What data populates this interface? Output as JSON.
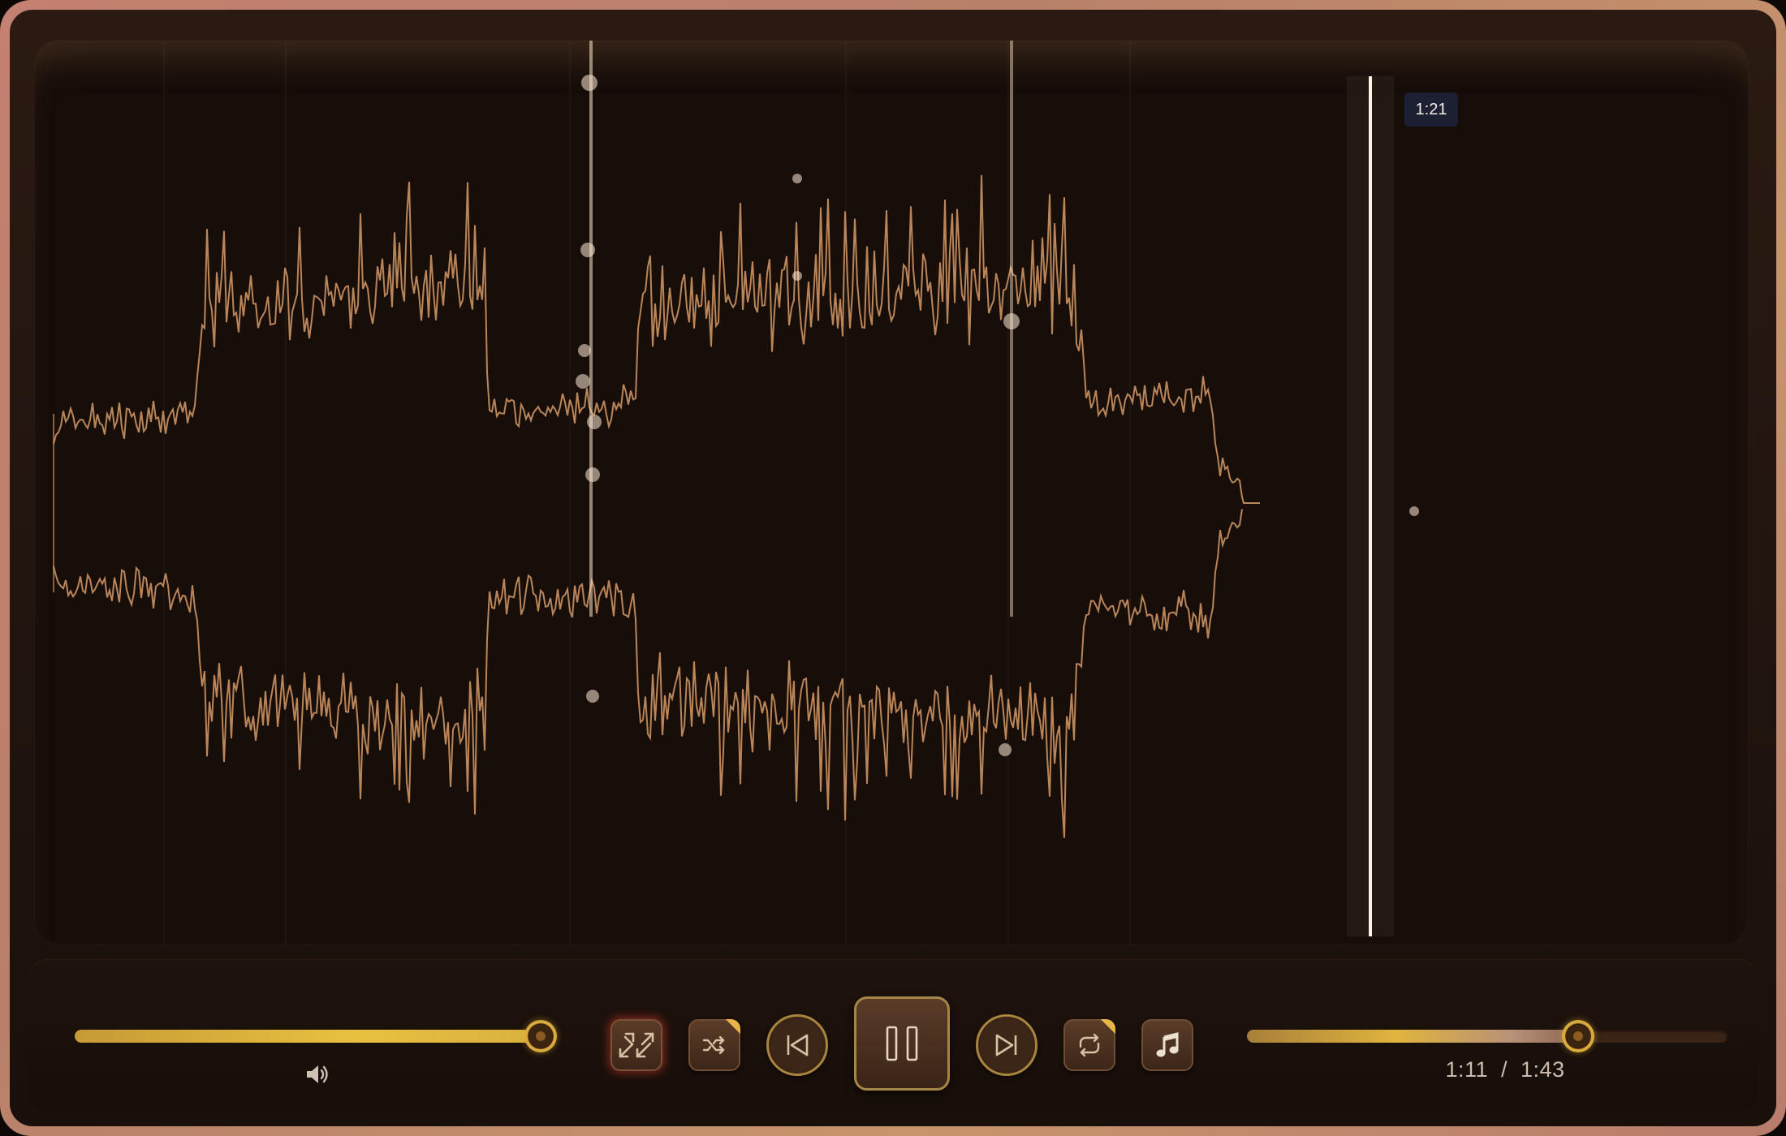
{
  "player": {
    "hover_time": "1:21",
    "time_display": "1:11  /  1:43",
    "volume_level": 0.97,
    "progress": 0.69,
    "state": "playing"
  },
  "controls": {
    "buttons": [
      {
        "name": "fullscreen",
        "icon": "expand-arrows-icon",
        "active": true
      },
      {
        "name": "shuffle",
        "icon": "shuffle-icon"
      },
      {
        "name": "previous",
        "icon": "skip-back-icon"
      },
      {
        "name": "play-pause",
        "icon": "pause-icon"
      },
      {
        "name": "next",
        "icon": "skip-forward-icon"
      },
      {
        "name": "repeat",
        "icon": "repeat-icon"
      },
      {
        "name": "playlist",
        "icon": "music-note-icon"
      }
    ],
    "volume_icon": "speaker-icon"
  },
  "colors": {
    "waveform": "#d79a66",
    "accent_gold": "#d8b040",
    "playhead": "#fff4e6",
    "tooltip_bg": "#1d1f33"
  }
}
